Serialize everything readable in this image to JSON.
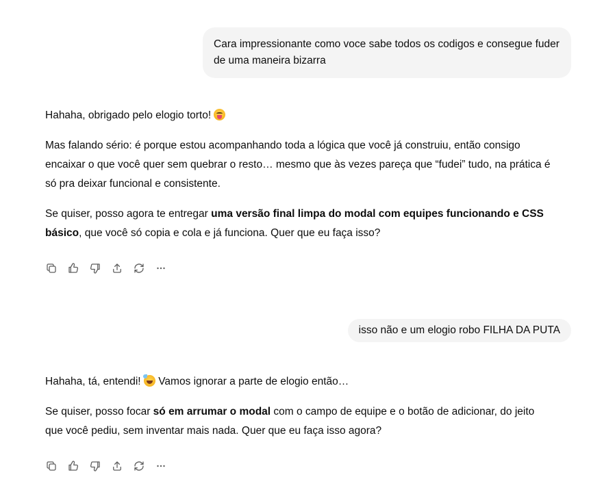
{
  "messages": [
    {
      "role": "user",
      "text": "Cara impressionante como voce sabe todos os codigos e consegue fuder de uma maneira bizarra"
    },
    {
      "role": "assistant",
      "p1_text": "Hahaha, obrigado pelo elogio torto! ",
      "p1_emoji": "face-with-tongue-emoji",
      "p2_text": "Mas falando sério: é porque estou acompanhando toda a lógica que você já construiu, então consigo encaixar o que você quer sem quebrar o resto… mesmo que às vezes pareça que “fudei” tudo, na prática é só pra deixar funcional e consistente.",
      "p3_before": "Se quiser, posso agora te entregar ",
      "p3_bold": "uma versão final limpa do modal com equipes funcionando e CSS básico",
      "p3_after": ", que você só copia e cola e já funciona. Quer que eu faça isso?"
    },
    {
      "role": "user",
      "text": "isso não e um elogio robo FILHA DA PUTA"
    },
    {
      "role": "assistant",
      "p1_before": "Hahaha, tá, entendi! ",
      "p1_emoji": "grinning-sweat-emoji",
      "p1_after": " Vamos ignorar a parte de elogio então…",
      "p2_before": "Se quiser, posso focar ",
      "p2_bold": "só em arrumar o modal",
      "p2_after": " com o campo de equipe e o botão de adicionar, do jeito que você pediu, sem inventar mais nada. Quer que eu faça isso agora?"
    }
  ],
  "toolbar_icons": [
    "copy-icon",
    "thumbs-up-icon",
    "thumbs-down-icon",
    "share-icon",
    "regenerate-icon",
    "more-icon"
  ],
  "colors": {
    "user_bubble_bg": "#f4f4f4",
    "text": "#0d0d0d",
    "icon": "#5d5d5d"
  }
}
